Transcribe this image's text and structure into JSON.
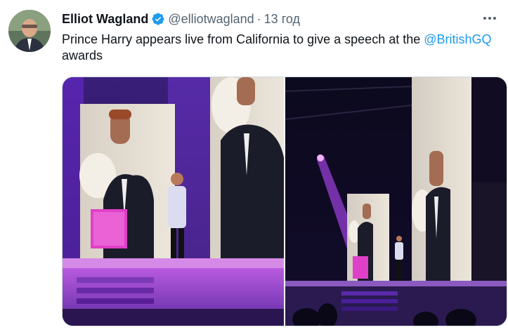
{
  "tweet": {
    "author_name": "Elliot Wagland",
    "handle": "@elliotwagland",
    "separator": "·",
    "time": "13 год",
    "text_before": "Prince Harry appears live from California to give a speech at the ",
    "mention": "@BritishGQ",
    "text_after": " awards"
  },
  "icons": {
    "verified": "verified-badge-icon",
    "more": "more-options-icon"
  },
  "colors": {
    "accent": "#1d9bf0",
    "text": "#0f1419",
    "muted": "#536471"
  }
}
